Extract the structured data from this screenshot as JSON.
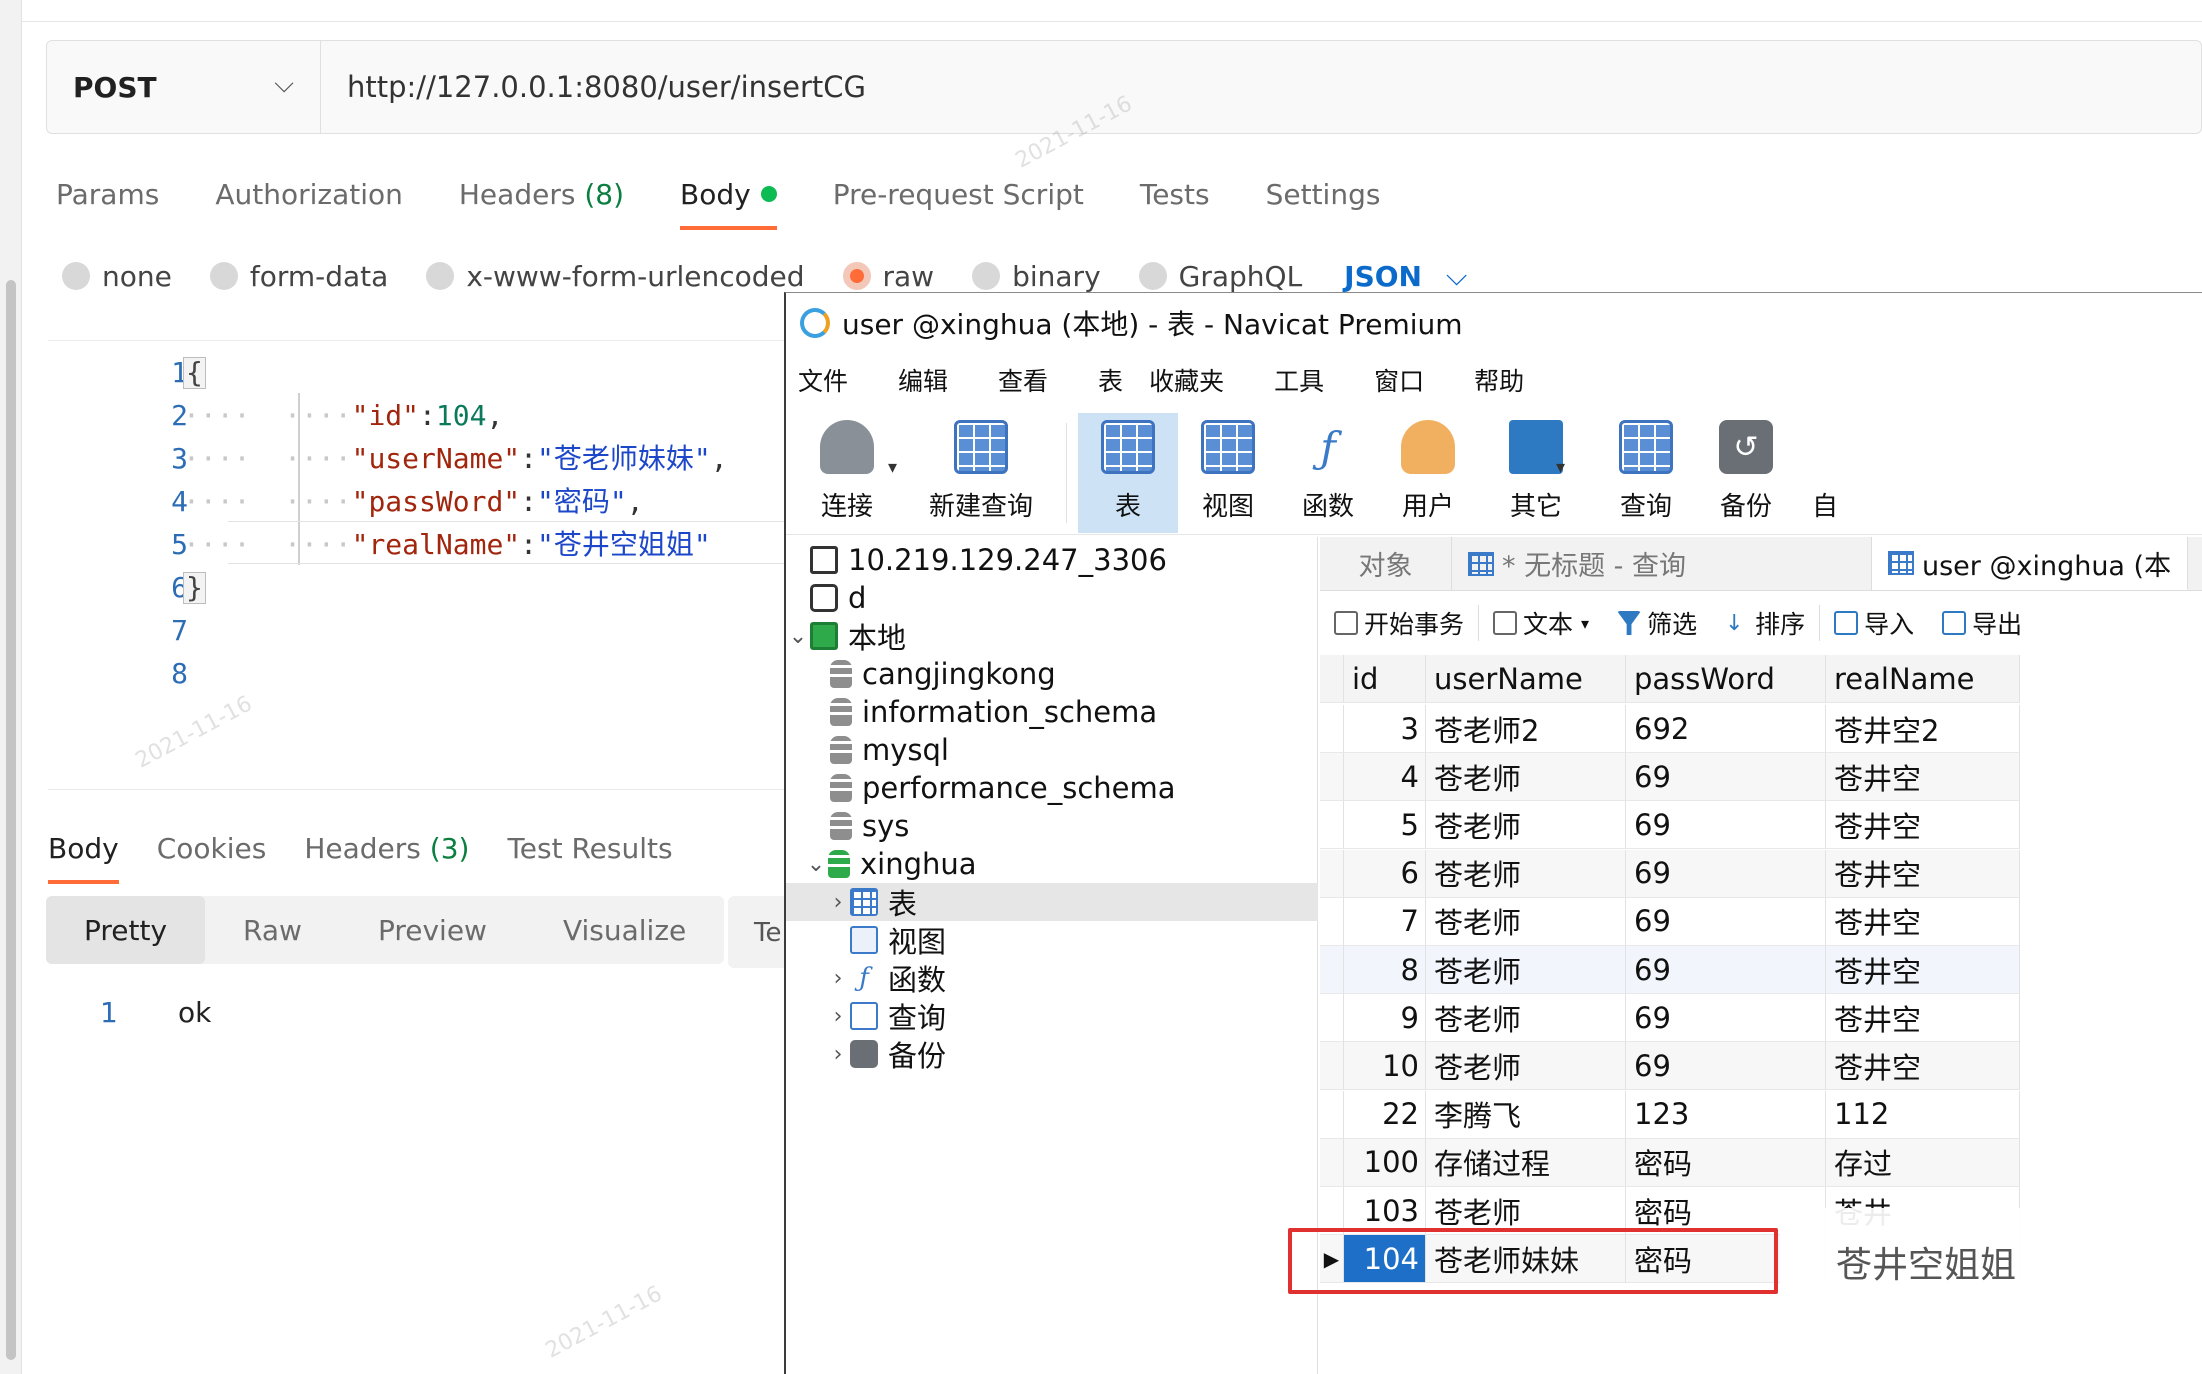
{
  "postman": {
    "method": "POST",
    "url": "http://127.0.0.1:8080/user/insertCG",
    "request_tabs": [
      {
        "label": "Params"
      },
      {
        "label": "Authorization"
      },
      {
        "label": "Headers",
        "count": "(8)"
      },
      {
        "label": "Body"
      },
      {
        "label": "Pre-request Script"
      },
      {
        "label": "Tests"
      },
      {
        "label": "Settings"
      }
    ],
    "body_types": [
      "none",
      "form-data",
      "x-www-form-urlencoded",
      "raw",
      "binary",
      "GraphQL"
    ],
    "body_format": "JSON",
    "editor": {
      "line_numbers": [
        "1",
        "2",
        "3",
        "4",
        "5",
        "6",
        "7",
        "8"
      ],
      "open_brace": "{",
      "close_brace": "}",
      "fields": [
        {
          "key": "\"id\"",
          "value": "104",
          "suffix": ","
        },
        {
          "key": "\"userName\"",
          "value": "\"苍老师妹妹\"",
          "suffix": ","
        },
        {
          "key": "\"passWord\"",
          "value": "\"密码\"",
          "suffix": ","
        },
        {
          "key": "\"realName\"",
          "value": "\"苍井空姐姐\"",
          "suffix": ""
        }
      ]
    },
    "response_tabs": [
      {
        "label": "Body"
      },
      {
        "label": "Cookies"
      },
      {
        "label": "Headers",
        "count": "(3)"
      },
      {
        "label": "Test Results"
      }
    ],
    "view_tabs": [
      "Pretty",
      "Raw",
      "Preview",
      "Visualize"
    ],
    "view_tab_extra": "Te",
    "response": {
      "line": "1",
      "text": "ok"
    }
  },
  "navicat": {
    "title": "user @xinghua (本地) - 表 - Navicat Premium",
    "menu": [
      "文件",
      "编辑",
      "查看",
      "表",
      "收藏夹",
      "工具",
      "窗口",
      "帮助"
    ],
    "toolbar": [
      "连接",
      "新建查询",
      "表",
      "视图",
      "函数",
      "用户",
      "其它",
      "查询",
      "备份",
      "自"
    ],
    "tree": {
      "connection1": "10.219.129.247_3306",
      "connection2": "d",
      "local": "本地",
      "databases": [
        "cangjingkong",
        "information_schema",
        "mysql",
        "performance_schema",
        "sys",
        "xinghua"
      ],
      "xinghua_children": [
        "表",
        "视图",
        "函数",
        "查询",
        "备份"
      ]
    },
    "object_tabs": {
      "objects": "对象",
      "query": "* 无标题 - 查询",
      "table": "user @xinghua (本"
    },
    "data_toolbar": [
      "开始事务",
      "文本",
      "筛选",
      "排序",
      "导入",
      "导出"
    ],
    "columns": [
      "id",
      "userName",
      "passWord",
      "realName"
    ],
    "rows": [
      [
        "3",
        "苍老师2",
        "692",
        "苍井空2"
      ],
      [
        "4",
        "苍老师",
        "69",
        "苍井空"
      ],
      [
        "5",
        "苍老师",
        "69",
        "苍井空"
      ],
      [
        "6",
        "苍老师",
        "69",
        "苍井空"
      ],
      [
        "7",
        "苍老师",
        "69",
        "苍井空"
      ],
      [
        "8",
        "苍老师",
        "69",
        "苍井空"
      ],
      [
        "9",
        "苍老师",
        "69",
        "苍井空"
      ],
      [
        "10",
        "苍老师",
        "69",
        "苍井空"
      ],
      [
        "22",
        "李腾飞",
        "123",
        "112"
      ],
      [
        "100",
        "存储过程",
        "密码",
        "存过"
      ],
      [
        "103",
        "苍老师",
        "密码",
        "苍井"
      ],
      [
        "104",
        "苍老师妹妹",
        "密码",
        ""
      ]
    ],
    "selected_row_realname": "苍井空姐姐",
    "highlight_color": "#e03030",
    "selection_color": "#1d6fc8"
  },
  "watermark": "2021-11-16"
}
